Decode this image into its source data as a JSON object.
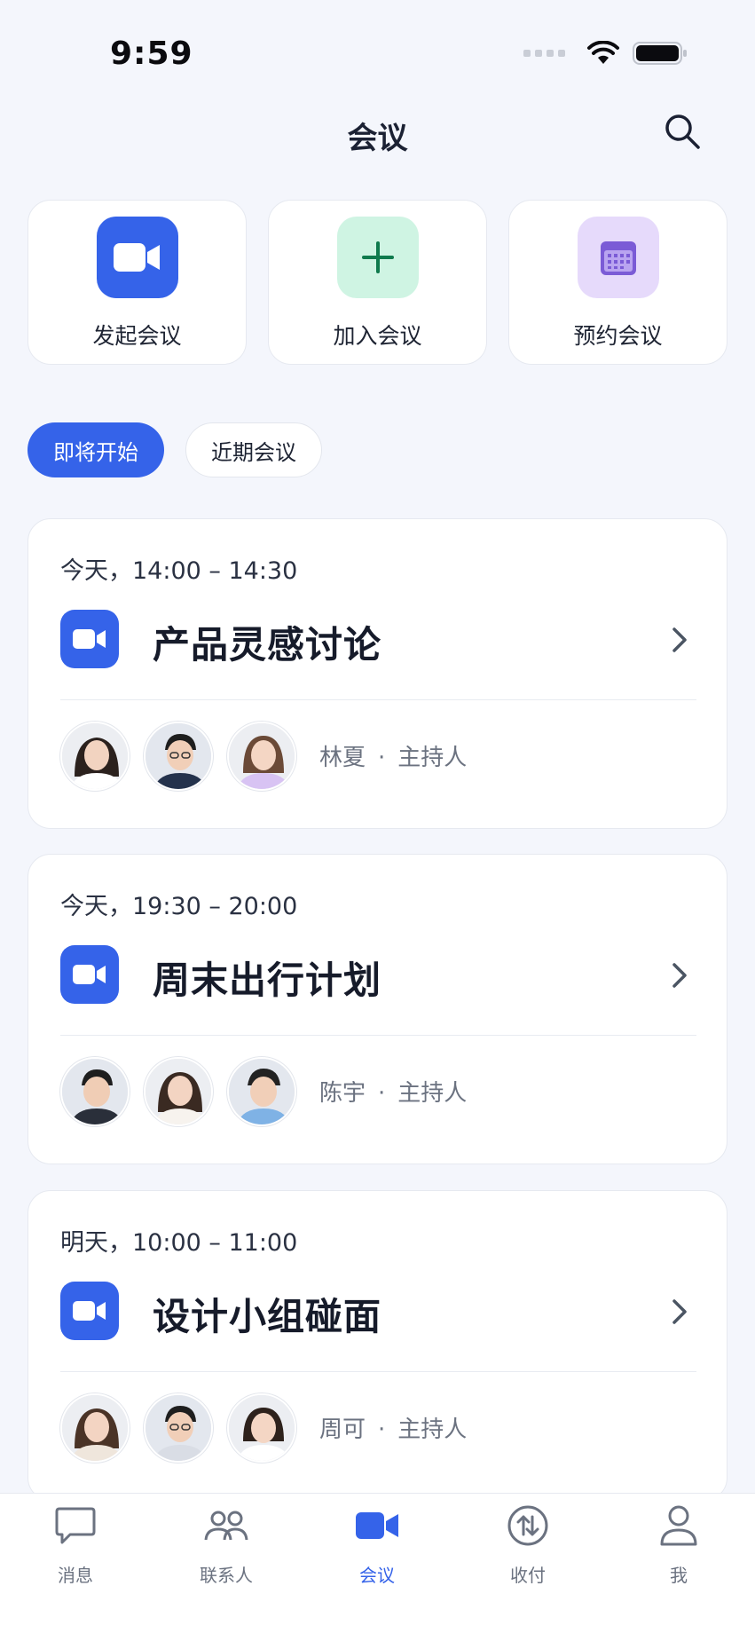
{
  "status_bar": {
    "time": "9:59"
  },
  "header": {
    "title": "会议"
  },
  "quick_actions": [
    {
      "label": "发起会议",
      "icon": "video-camera-icon",
      "bg": "#3563E9"
    },
    {
      "label": "加入会议",
      "icon": "plus-icon",
      "bg": "#CFF4E3"
    },
    {
      "label": "预约会议",
      "icon": "calendar-icon",
      "bg": "#E6DAFB"
    }
  ],
  "segments": {
    "upcoming": "即将开始",
    "recent": "近期会议",
    "selected": "即将开始"
  },
  "meetings": [
    {
      "time": "今天，14:00 – 14:30",
      "title": "产品灵感讨论",
      "host_name": "林夏",
      "host_role": "主持人"
    },
    {
      "time": "今天，19:30 – 20:00",
      "title": "周末出行计划",
      "host_name": "陈宇",
      "host_role": "主持人"
    },
    {
      "time": "明天，10:00 – 11:00",
      "title": "设计小组碰面",
      "host_name": "周可",
      "host_role": "主持人"
    }
  ],
  "tabbar": [
    {
      "label": "消息",
      "icon": "chat-bubble-icon"
    },
    {
      "label": "联系人",
      "icon": "contacts-icon"
    },
    {
      "label": "会议",
      "icon": "video-camera-icon",
      "active": true
    },
    {
      "label": "收付",
      "icon": "transfer-icon"
    },
    {
      "label": "我",
      "icon": "person-icon"
    }
  ],
  "colors": {
    "accent": "#3563E9",
    "background": "#F4F6FC"
  }
}
